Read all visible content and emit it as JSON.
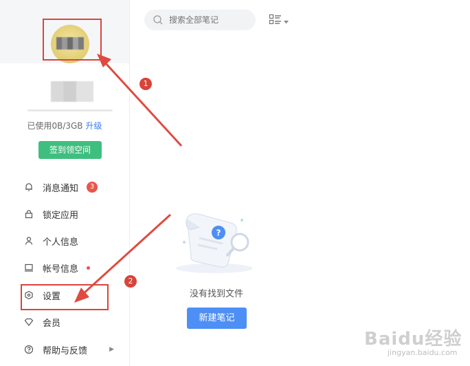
{
  "sidebar": {
    "storage_text": "已使用0B/3GB",
    "upgrade_label": "升级",
    "checkin_label": "签到领空间",
    "menu": {
      "notifications": {
        "label": "消息通知",
        "badge": "3"
      },
      "lock_app": {
        "label": "锁定应用"
      },
      "personal_info": {
        "label": "个人信息"
      },
      "account_info": {
        "label": "帐号信息"
      },
      "settings": {
        "label": "设置"
      },
      "membership": {
        "label": "会员"
      },
      "help_feedback": {
        "label": "帮助与反馈"
      }
    }
  },
  "search": {
    "placeholder": "搜索全部笔记"
  },
  "main": {
    "empty_text": "没有找到文件",
    "new_note_label": "新建笔记"
  },
  "annotations": {
    "step1": "1",
    "step2": "2"
  },
  "watermark": {
    "main": "Baidu经验",
    "sub": "jingyan.baidu.com"
  },
  "colors": {
    "accent_green": "#3fbf7f",
    "accent_blue": "#4e8ff6",
    "link_blue": "#3a7afe",
    "annotation_red": "#d9443a",
    "badge_red": "#e8554a"
  }
}
